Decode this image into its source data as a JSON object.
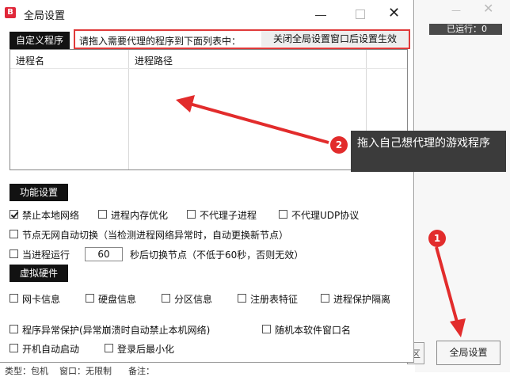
{
  "background": {
    "running_label": "已运行：0",
    "minimize_glyph": "—",
    "close_glyph": "✕",
    "partial_button_label": "区",
    "global_settings_button": "全局设置",
    "status_line": "类型：包机    窗口：无限制      备注："
  },
  "dialog": {
    "logo_letter": "B",
    "title": "全局设置",
    "close_glyph": "✕",
    "custom_programs": {
      "section_label": "自定义程序",
      "hint": "请拖入需要代理的程序到下面列表中：",
      "notice": "关闭全局设置窗口后设置生效",
      "columns": [
        "进程名",
        "进程路径"
      ],
      "rows": []
    },
    "function_settings": {
      "section_label": "功能设置",
      "options": [
        {
          "label": "禁止本地网络",
          "checked": true
        },
        {
          "label": "进程内存优化",
          "checked": false
        },
        {
          "label": "不代理子进程",
          "checked": false
        },
        {
          "label": "不代理UDP协议",
          "checked": false
        },
        {
          "label": "节点无网自动切换（当检测进程网络异常时，自动更换新节点）",
          "checked": false
        },
        {
          "label": "当进程运行",
          "checked": false
        }
      ],
      "switch_seconds_value": "60",
      "switch_suffix": "秒后切换节点（不低于60秒，否则无效）"
    },
    "virtual_hardware": {
      "section_label": "虚拟硬件",
      "options": [
        {
          "label": "网卡信息",
          "checked": false
        },
        {
          "label": "硬盘信息",
          "checked": false
        },
        {
          "label": "分区信息",
          "checked": false
        },
        {
          "label": "注册表特征",
          "checked": false
        },
        {
          "label": "进程保护隔离",
          "checked": false
        }
      ]
    },
    "misc_options": [
      {
        "label": "程序异常保护(异常崩溃时自动禁止本机网络)",
        "checked": false
      },
      {
        "label": "随机本软件窗口名",
        "checked": false
      },
      {
        "label": "开机自动启动",
        "checked": false
      },
      {
        "label": "登录后最小化",
        "checked": false
      }
    ]
  },
  "annotations": {
    "step1": "1",
    "step2": "2",
    "tooltip": "拖入自己想代理的游戏程序",
    "accent_color": "#e22c2c"
  }
}
